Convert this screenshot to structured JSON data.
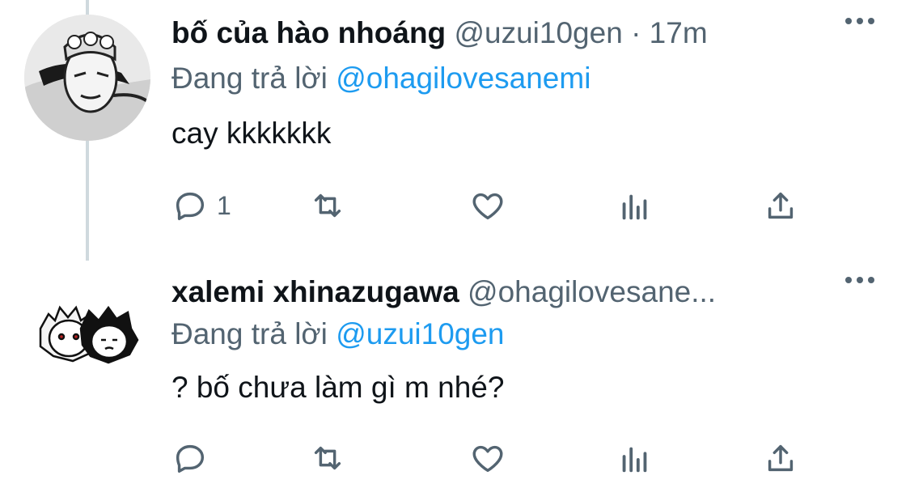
{
  "tweets": [
    {
      "display_name": "bố của hào nhoáng",
      "handle": "@uzui10gen",
      "separator": "·",
      "time": "17m",
      "reply_prefix": "Đang trả lời",
      "reply_to": "@ohagilovesanemi",
      "text": "cay kkkkkkk",
      "reply_count": "1",
      "avatar_icon": "manga-character-avatar"
    },
    {
      "display_name": "xalemi xhinazugawa",
      "handle": "@ohagilovesane...",
      "reply_prefix": "Đang trả lời",
      "reply_to": "@uzui10gen",
      "text": "? bố chưa làm gì m nhé?",
      "reply_count": "",
      "avatar_icon": "two-chibi-characters-avatar"
    }
  ],
  "colors": {
    "link": "#1d9bf0",
    "secondary_text": "#536471",
    "primary_text": "#0f1419",
    "thread_line": "#cfd9de"
  },
  "icons": [
    "reply-icon",
    "retweet-icon",
    "like-icon",
    "views-icon",
    "share-icon",
    "more-icon"
  ]
}
